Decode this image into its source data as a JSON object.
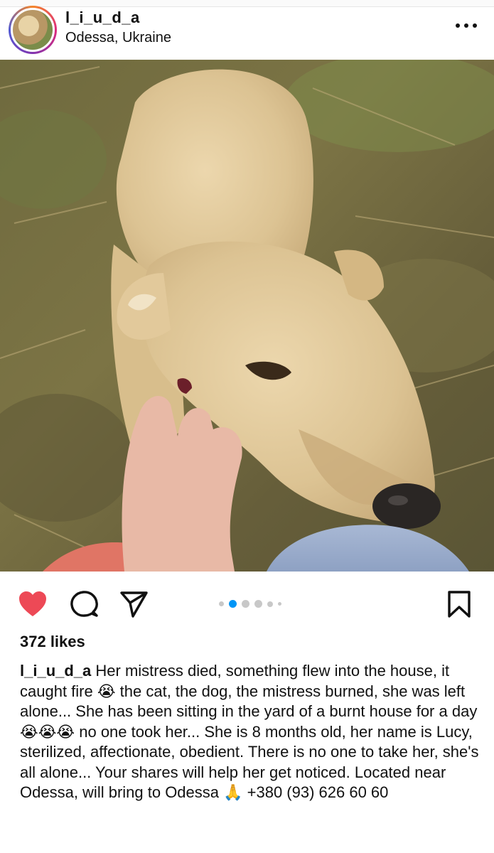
{
  "header": {
    "username": "l_i_u_d_a",
    "location": "Odessa, Ukraine",
    "more_icon": "more-horizontal-icon"
  },
  "post": {
    "image_description_icon": "dog-photo",
    "carousel": {
      "count": 6,
      "active_index": 1
    },
    "likes": "372 likes",
    "liked": true,
    "caption_user": "l_i_u_d_a",
    "caption_text": "Her mistress died, something flew into the house, it caught fire 😭 the cat, the dog, the mistress burned, she was left alone... She has been sitting in the yard of a burnt house for a day 😭😭😭 no one took her... She is 8 months old, her name is Lucy, sterilized, affectionate, obedient. There is no one to take her, she's all alone... Your shares will help her get noticed. Located near Odessa, will bring to Odessa 🙏 +380 (93) 626 60 60"
  },
  "icons": {
    "like": "heart-icon",
    "comment": "comment-icon",
    "share": "send-icon",
    "save": "bookmark-icon"
  },
  "colors": {
    "like_red": "#ed4956",
    "carousel_active": "#0095f6",
    "carousel_inactive": "#c8c8c8"
  }
}
